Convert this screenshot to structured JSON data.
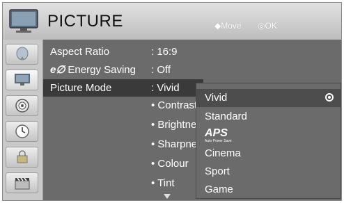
{
  "header": {
    "title": "PICTURE",
    "hint_move": "Move",
    "hint_ok": "OK",
    "icon": "tv-icon"
  },
  "sidebar": {
    "items": [
      {
        "icon": "satellite-dish-icon"
      },
      {
        "icon": "monitor-icon"
      },
      {
        "icon": "speaker-icon"
      },
      {
        "icon": "clock-icon"
      },
      {
        "icon": "lock-icon"
      },
      {
        "icon": "clapperboard-icon"
      }
    ]
  },
  "menu": {
    "rows": [
      {
        "label": "Aspect Ratio",
        "value": ": 16:9"
      },
      {
        "label": "Energy Saving",
        "value": ": Off"
      },
      {
        "label": "Picture Mode",
        "value": ": Vivid"
      }
    ],
    "energy_prefix": "e∅",
    "sub_items": [
      "• Contrast",
      "• Brightnes",
      "• Sharpnes",
      "• Colour",
      "• Tint"
    ]
  },
  "popup": {
    "items": [
      "Vivid",
      "Standard",
      "APS",
      "Cinema",
      "Sport",
      "Game"
    ],
    "aps_subtext": "Auto Power Save",
    "selected": "Vivid"
  }
}
